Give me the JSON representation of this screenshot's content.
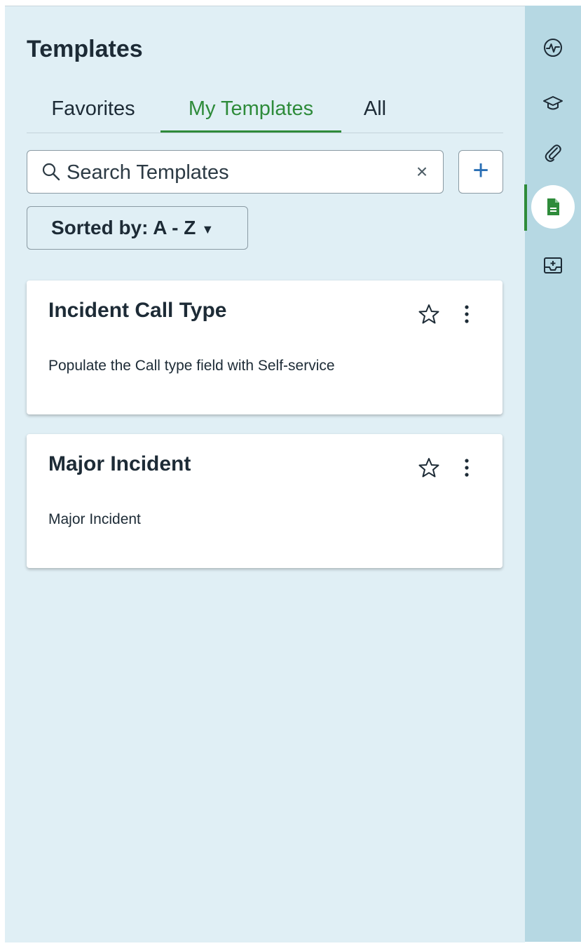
{
  "panel": {
    "title": "Templates"
  },
  "tabs": [
    {
      "label": "Favorites",
      "active": false
    },
    {
      "label": "My Templates",
      "active": true
    },
    {
      "label": "All",
      "active": false
    }
  ],
  "search": {
    "placeholder": "Search Templates",
    "value": ""
  },
  "sort": {
    "label": "Sorted by: A - Z"
  },
  "cards": [
    {
      "title": "Incident Call Type",
      "description": "Populate the Call type field with Self-service"
    },
    {
      "title": "Major Incident",
      "description": "Major Incident"
    }
  ],
  "rail": {
    "items": [
      "activity-icon",
      "graduation-cap-icon",
      "paperclip-icon",
      "document-icon",
      "inbox-add-icon"
    ],
    "active": "document-icon"
  },
  "colors": {
    "accent": "#2e8b3a",
    "panel_bg": "#e0eff5",
    "rail_bg": "#b6d8e3",
    "link_blue": "#2a6fb5"
  }
}
